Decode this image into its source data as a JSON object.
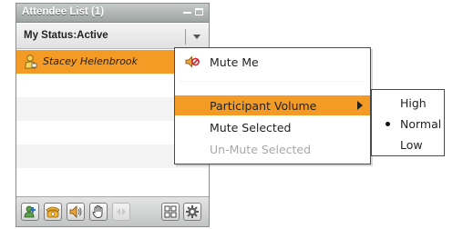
{
  "panel": {
    "title": "Attendee List (1)",
    "status_label": "My Status:Active"
  },
  "attendees": [
    {
      "name": "Stacey Helenbrook",
      "icon": "presenter-person-icon",
      "selected": true
    }
  ],
  "toolbar": {
    "buttons": [
      {
        "icon": "add-person-icon",
        "enabled": true
      },
      {
        "icon": "telephone-icon",
        "enabled": true
      },
      {
        "icon": "speaker-volume-icon",
        "enabled": true
      },
      {
        "icon": "raise-hand-icon",
        "enabled": true
      },
      {
        "icon": "disabled-arrows-icon",
        "enabled": false
      },
      {
        "icon": "grid-view-icon",
        "enabled": true
      },
      {
        "icon": "settings-gear-icon",
        "enabled": true
      }
    ]
  },
  "context_menu": {
    "mute_me": "Mute Me",
    "participant_volume": "Participant Volume",
    "mute_selected": "Mute Selected",
    "unmute_selected": "Un-Mute Selected"
  },
  "volume_submenu": {
    "options": [
      "High",
      "Normal",
      "Low"
    ],
    "selected": "Normal"
  },
  "colors": {
    "highlight": "#f39b25",
    "title_bar": "#9ea4a1",
    "menu_border": "#4a4a4a"
  }
}
